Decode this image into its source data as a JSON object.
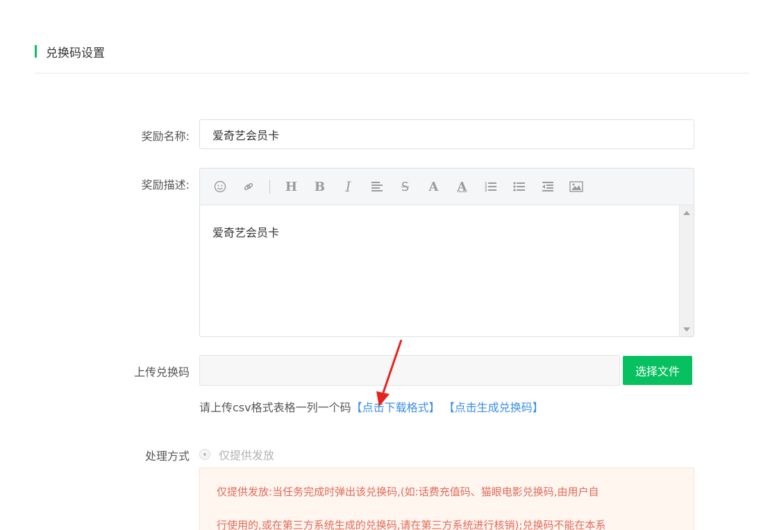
{
  "section": {
    "title": "兑换码设置"
  },
  "form": {
    "name_label": "奖励名称:",
    "name_value": "爱奇艺会员卡",
    "desc_label": "奖励描述:",
    "desc_content": "爱奇艺会员卡",
    "toolbar": [
      {
        "name": "emoji-icon",
        "glyph": "☺"
      },
      {
        "name": "link-icon",
        "glyph": "🔗"
      },
      {
        "name": "heading-icon",
        "glyph": "H"
      },
      {
        "name": "bold-icon",
        "glyph": "B"
      },
      {
        "name": "italic-icon",
        "glyph": "I"
      },
      {
        "name": "align-left-icon",
        "glyph": "≡"
      },
      {
        "name": "strikethrough-icon",
        "glyph": "S"
      },
      {
        "name": "font-size-icon",
        "glyph": "A"
      },
      {
        "name": "font-color-icon",
        "glyph": "A"
      },
      {
        "name": "ordered-list-icon",
        "glyph": "☰"
      },
      {
        "name": "unordered-list-icon",
        "glyph": "☰"
      },
      {
        "name": "outdent-icon",
        "glyph": "⇤"
      },
      {
        "name": "image-icon",
        "glyph": "▣"
      }
    ],
    "upload_label": "上传兑换码",
    "upload_button": "选择文件",
    "help_text": "请上传csv格式表格一列一个码",
    "download_link": "【点击下载格式】",
    "generate_link": "【点击生成兑换码】",
    "process_label": "处理方式",
    "process_option": "仅提供发放",
    "notice_line1_strong": "仅提供发放:",
    "notice_line1": "当任务完成时弹出该兑换码,(如:话费充值码、猫眼电影兑换码,由用户自",
    "notice_line2": "行使用的,或在第三方系统生成的兑换码,请在第三方系统进行核销);兑换码不能在本系"
  },
  "colors": {
    "accent": "#07c160",
    "link": "#3a8ee6",
    "notice_text": "#e06b5a",
    "annotation_arrow": "#e8231d"
  }
}
